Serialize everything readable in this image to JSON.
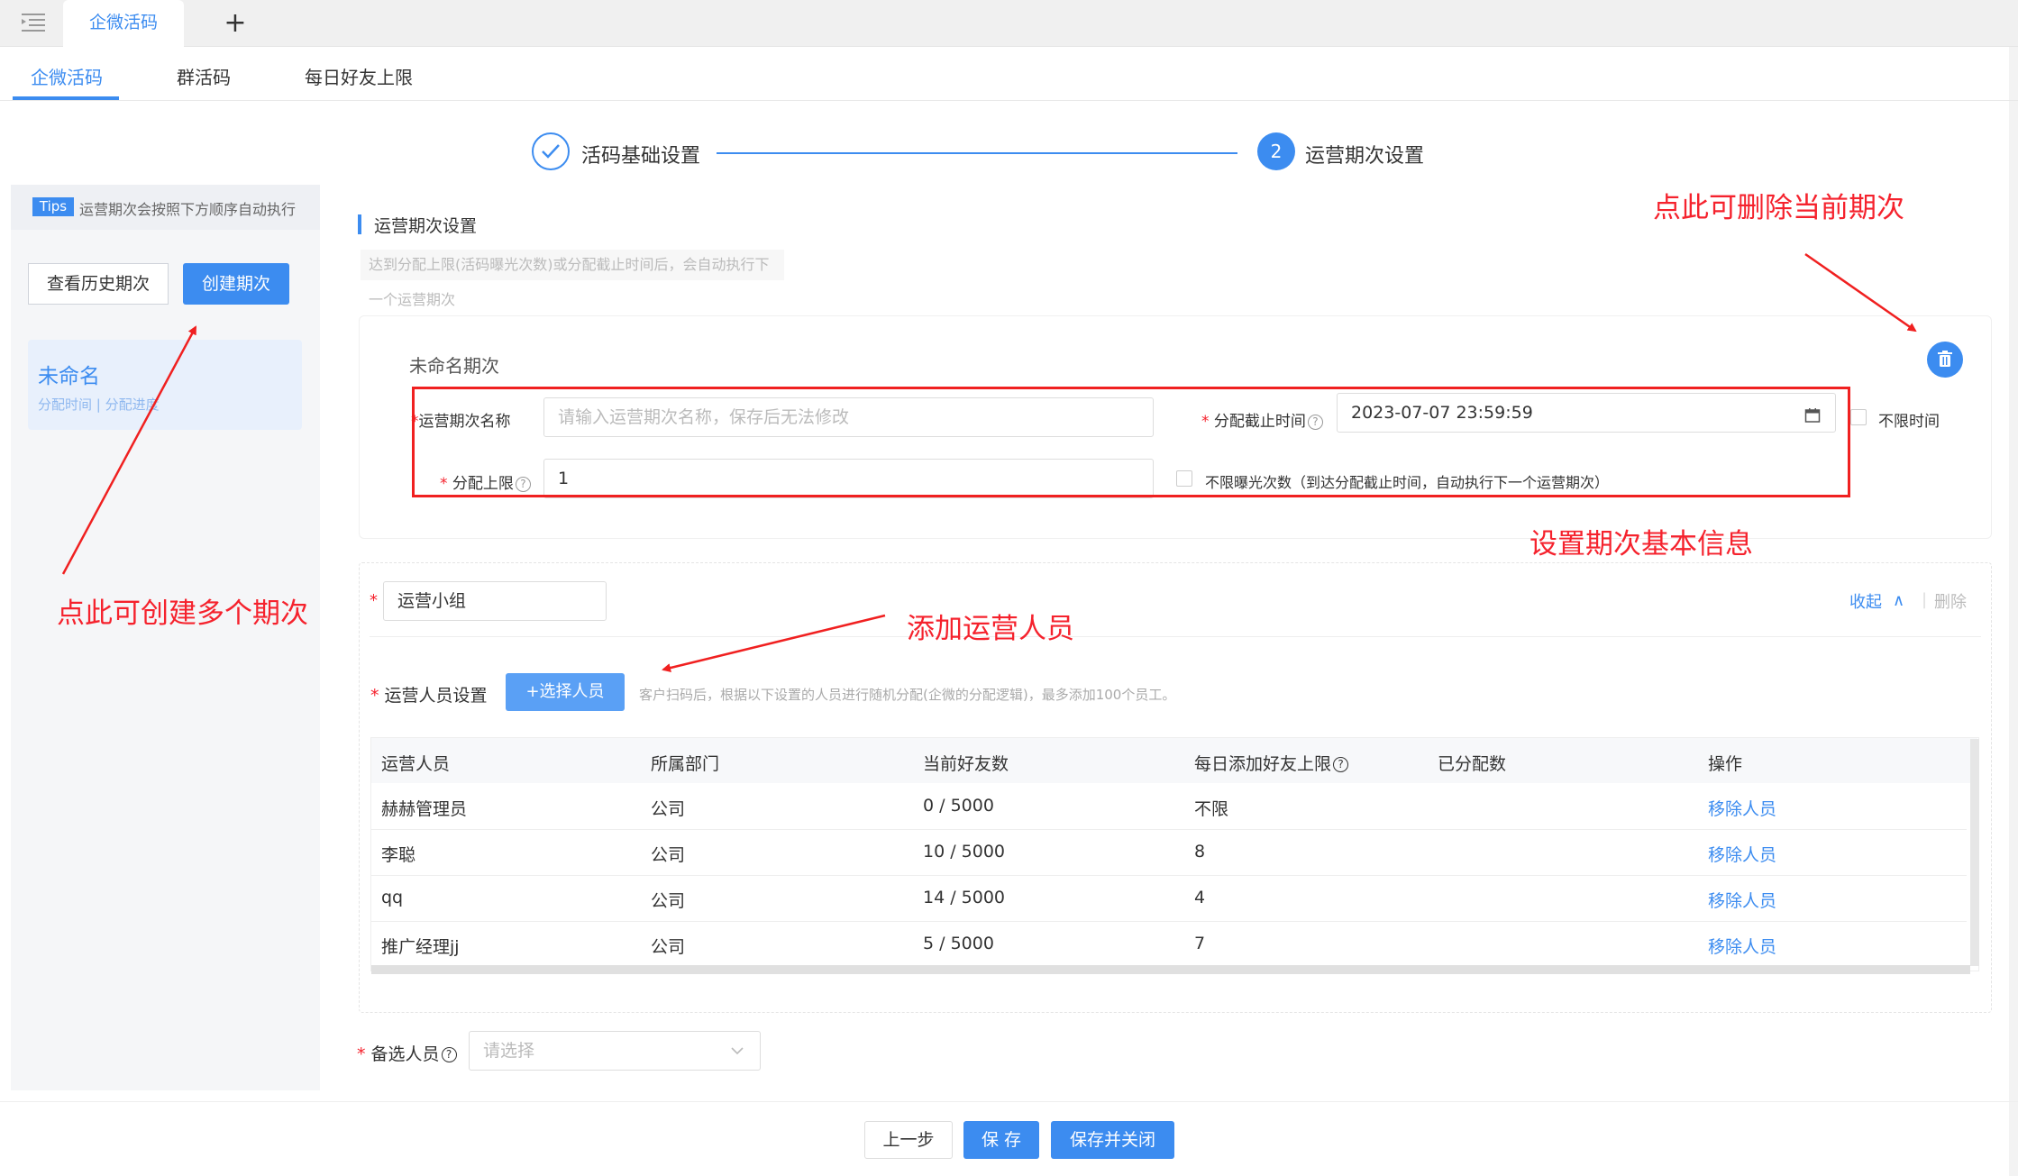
{
  "window": {
    "tab_active": "企微活码",
    "tab_add": "+"
  },
  "subtabs": [
    "企微活码",
    "群活码",
    "每日好友上限"
  ],
  "steps": {
    "step1_label": "活码基础设置",
    "step2_number": "2",
    "step2_label": "运营期次设置"
  },
  "left_panel": {
    "tips_badge": "Tips",
    "tips_text": "运营期次会按照下方顺序自动执行",
    "history_button": "查看历史期次",
    "create_button": "创建期次",
    "period_card": {
      "title": "未命名",
      "meta": "分配时间 | 分配进度"
    }
  },
  "section": {
    "title": "运营期次设置",
    "note_line1": "达到分配上限(活码曝光次数)或分配截止时间后，会自动执行下",
    "note_line2": "一个运营期次"
  },
  "period_form": {
    "name": "未命名期次",
    "name_label": "运营期次名称",
    "name_placeholder": "请输入运营期次名称，保存后无法修改",
    "deadline_label": "分配截止时间",
    "deadline_value": "2023-07-07 23:59:59",
    "no_time_limit_label": "不限时间",
    "limit_label": "分配上限",
    "limit_value": "1",
    "unlimited_label": "不限曝光次数（到达分配截止时间，自动执行下一个运营期次）",
    "required_mark": "*",
    "help_mark": "?"
  },
  "annotations": {
    "delete": "点此可删除当前期次",
    "basic_info": "设置期次基本信息",
    "create_multiple": "点此可创建多个期次",
    "add_operators": "添加运营人员"
  },
  "group": {
    "name": "运营小组",
    "collapse": "收起",
    "collapse_glyph": "∧",
    "separator": "|",
    "delete": "删除",
    "operators_label": "运营人员设置",
    "select_button": "+选择人员",
    "hint": "客户扫码后，根据以下设置的人员进行随机分配(企微的分配逻辑)，最多添加100个员工。"
  },
  "table": {
    "headers": [
      "运营人员",
      "所属部门",
      "当前好友数",
      "每日添加好友上限",
      "已分配数",
      "操作"
    ],
    "rows": [
      {
        "name": "赫赫管理员",
        "dept": "公司",
        "friends": "0 / 5000",
        "daily_limit": "不限",
        "assigned": "",
        "action": "移除人员"
      },
      {
        "name": "李聪",
        "dept": "公司",
        "friends": "10 / 5000",
        "daily_limit": "8",
        "assigned": "",
        "action": "移除人员"
      },
      {
        "name": "qq",
        "dept": "公司",
        "friends": "14 / 5000",
        "daily_limit": "4",
        "assigned": "",
        "action": "移除人员"
      },
      {
        "name": "推广经理jj",
        "dept": "公司",
        "friends": "5 / 5000",
        "daily_limit": "7",
        "assigned": "",
        "action": "移除人员"
      }
    ]
  },
  "backup": {
    "label": "备选人员",
    "placeholder": "请选择"
  },
  "footer": {
    "prev": "上一步",
    "save": "保 存",
    "save_close": "保存并关闭"
  },
  "colors": {
    "accent": "#3c8cf0",
    "annotation_red": "#f5222d"
  }
}
